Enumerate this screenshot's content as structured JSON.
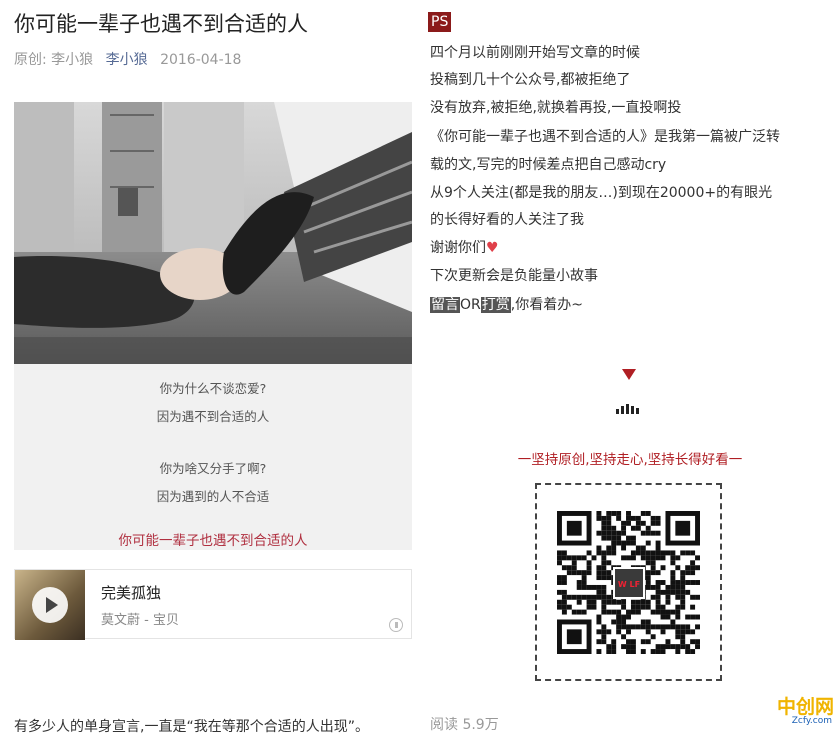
{
  "article": {
    "title": "你可能一辈子也遇不到合适的人",
    "source_label": "原创:",
    "author": "李小狼",
    "author_link": "李小狼",
    "date": "2016-04-18"
  },
  "caption": {
    "lines": [
      "你为什么不谈恋爱?",
      "因为遇不到合适的人",
      "你为啥又分手了啊?",
      "因为遇到的人不合适"
    ],
    "highlight": "你可能一辈子也遇不到合适的人"
  },
  "music": {
    "song": "完美孤独",
    "artist": "莫文蔚 - 宝贝",
    "icon": "play-icon"
  },
  "left_bottom_text": "有多少人的单身宣言,一直是“我在等那个合适的人出现”。",
  "ps": {
    "badge": "PS",
    "lines": [
      "四个月以前刚刚开始写文章的时候",
      "投稿到几十个公众号,都被拒绝了",
      "没有放弃,被拒绝,就换着再投,一直投啊投",
      "《你可能一辈子也遇不到合适的人》是我第一篇被广泛转",
      "载的文,写完的时候差点把自己感动cry",
      "从9个人关注(都是我的朋友…)到现在20000+的有眼光",
      "的长得好看的人关注了我",
      "谢谢你们",
      "下次更新会是负能量小故事"
    ],
    "heart": "♥",
    "hl_leave_msg": "留言",
    "hl_or": "OR",
    "hl_reward": "打赏",
    "tail": ",你看着办~"
  },
  "slogan": "一坚持原创,坚持走心,坚持长得好看一",
  "qr_logo": "W LF",
  "reads": "阅读 5.9万",
  "watermark": {
    "name": "中创网",
    "sub": "Zcfy.com"
  },
  "colors": {
    "accent_red": "#b01f24",
    "link_blue": "#576b95",
    "ps_badge": "#8b1a1a"
  }
}
